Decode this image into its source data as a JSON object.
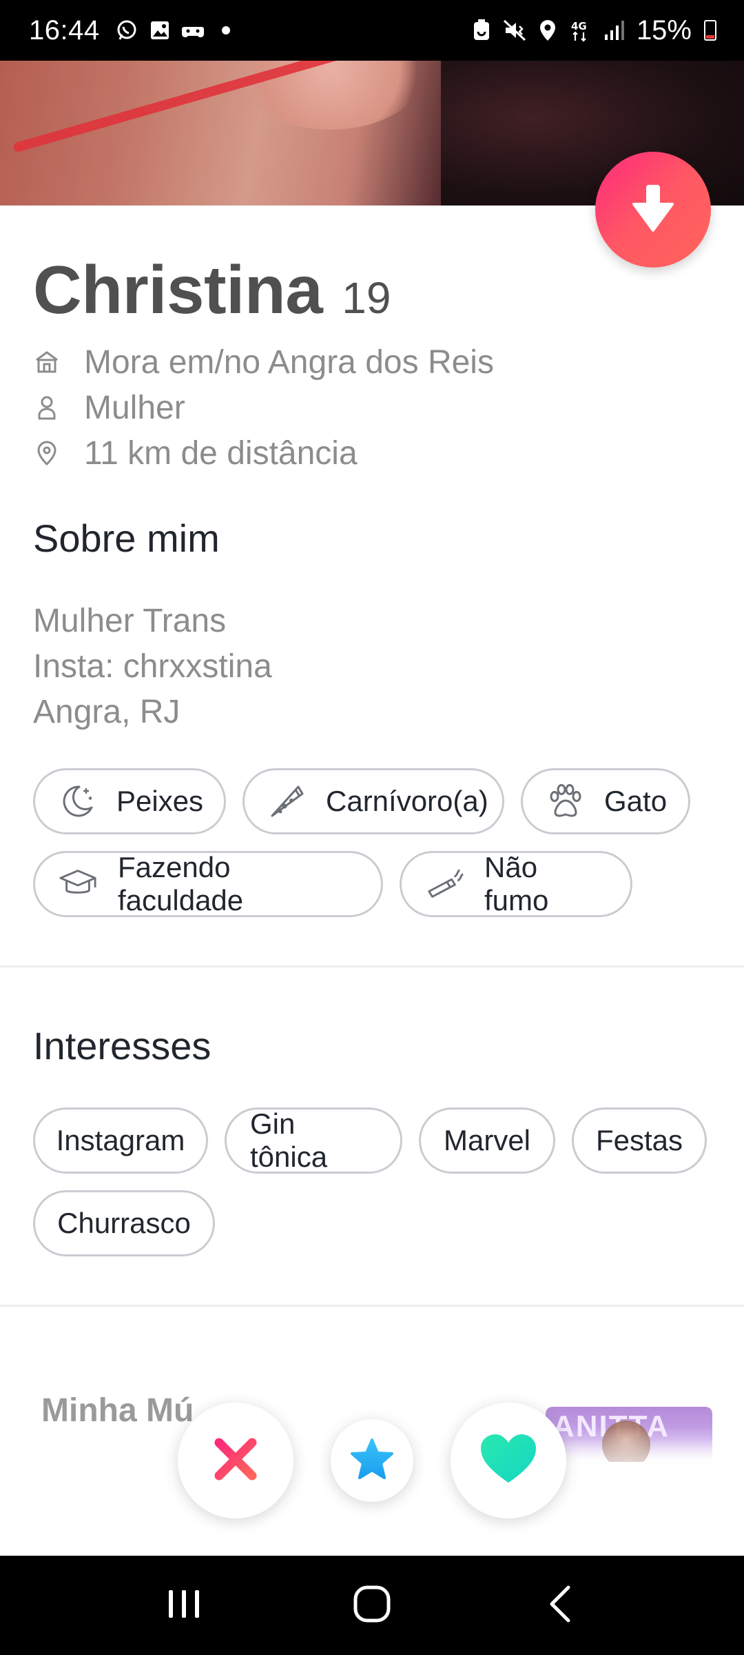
{
  "status_bar": {
    "time": "16:44",
    "battery": "15%",
    "battery_level": 0.15,
    "network": "4G",
    "left_icons": [
      "whatsapp-icon",
      "gallery-icon",
      "game-icon",
      "dot-icon"
    ],
    "right_icons": [
      "battery-saver-icon",
      "mute-vibrate-icon",
      "location-icon",
      "4g-icon",
      "signal-icon"
    ]
  },
  "profile": {
    "name": "Christina",
    "age": "19",
    "info": [
      {
        "icon": "home-icon",
        "text": "Mora em/no Angra dos Reis"
      },
      {
        "icon": "person-icon",
        "text": "Mulher"
      },
      {
        "icon": "location-pin-icon",
        "text": "11 km de distância"
      }
    ]
  },
  "about": {
    "title": "Sobre mim",
    "lines": [
      "Mulher Trans",
      "Insta: chrxxstina",
      "Angra, RJ"
    ]
  },
  "basics": [
    {
      "icon": "moon-icon",
      "label": "Peixes"
    },
    {
      "icon": "pizza-icon",
      "label": "Carnívoro(a)"
    },
    {
      "icon": "paw-icon",
      "label": "Gato"
    },
    {
      "icon": "graduation-cap-icon",
      "label": "Fazendo faculdade"
    },
    {
      "icon": "cigarette-icon",
      "label": "Não fumo"
    }
  ],
  "interests": {
    "title": "Interesses",
    "items": [
      "Instagram",
      "Gin tônica",
      "Marvel",
      "Festas",
      "Churrasco"
    ]
  },
  "music": {
    "title": "Minha Mú",
    "album_text": "ANITTA"
  },
  "colors": {
    "accent_gradient_start": "#fd297b",
    "accent_gradient_end": "#ff655b",
    "nope": "#fe4a64",
    "star": "#2db6f5",
    "like": "#21e3b6"
  }
}
